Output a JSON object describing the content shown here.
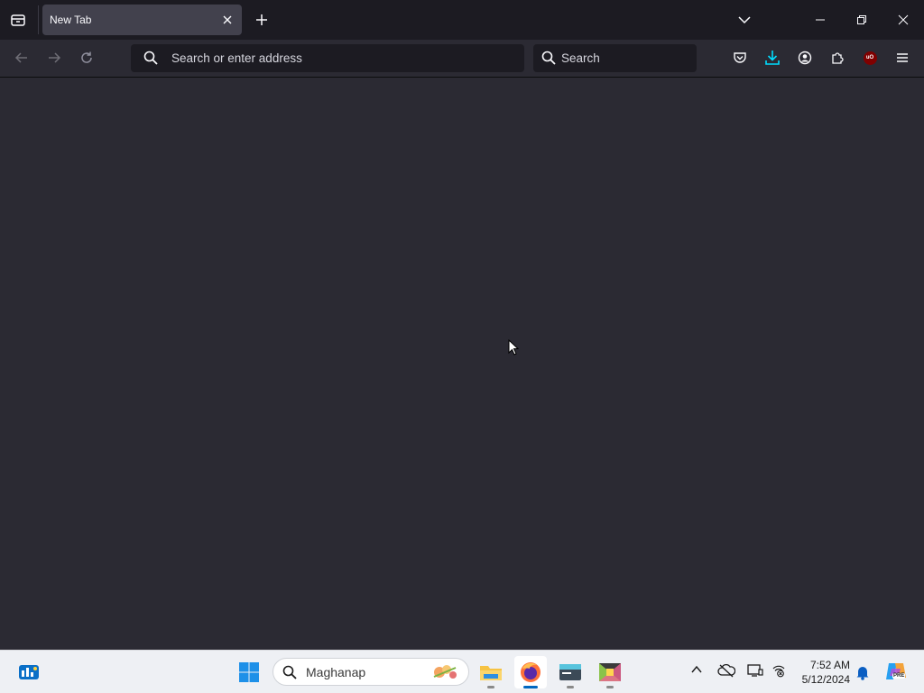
{
  "browser": {
    "tabs": [
      {
        "title": "New Tab",
        "active": true
      }
    ],
    "urlbar_placeholder": "Search or enter address",
    "searchbar_placeholder": "Search",
    "toolbar_icons": [
      "pocket-icon",
      "downloads-icon",
      "account-icon",
      "extensions-icon",
      "ublock-origin-icon",
      "menu-icon"
    ],
    "ublock_badge": "uO",
    "accent_color": "#00ddff"
  },
  "taskbar": {
    "search_label": "Maghanap",
    "pinned_apps": [
      "file-explorer",
      "firefox",
      "terminal",
      "image-app"
    ],
    "clock": {
      "time": "7:52 AM",
      "date": "5/12/2024"
    },
    "copilot_badge": "PRE"
  }
}
